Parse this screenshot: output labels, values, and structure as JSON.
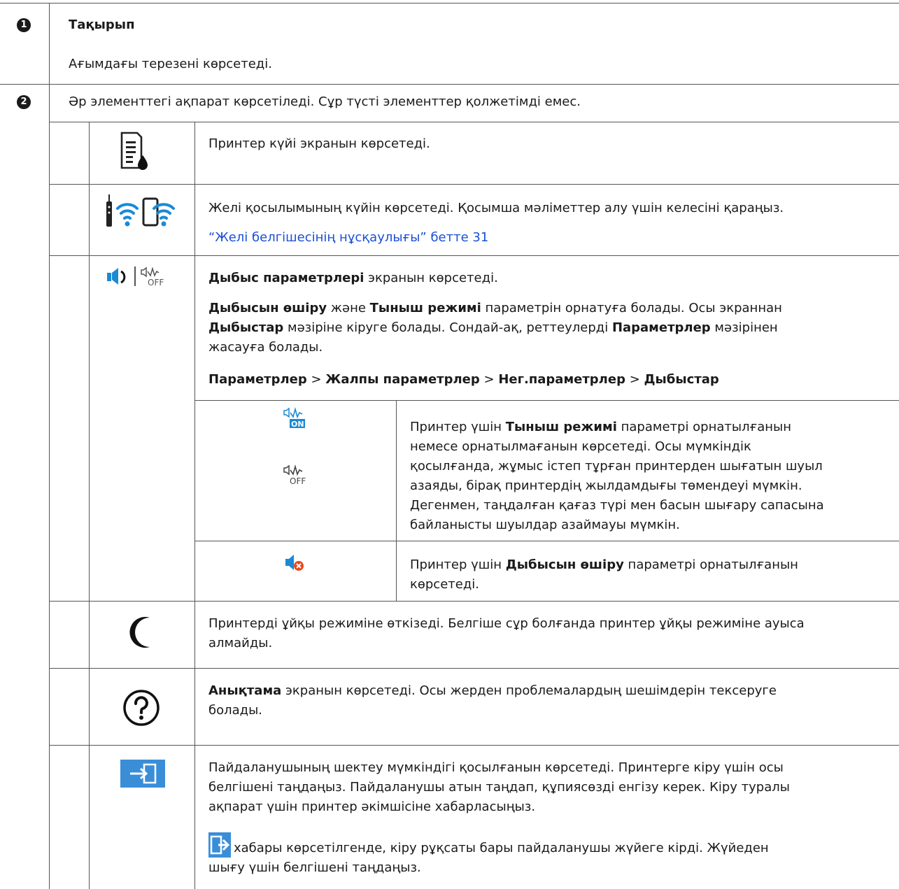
{
  "rows": {
    "r1": {
      "badge": "1",
      "title": "Тақырып",
      "desc": "Ағымдағы терезені көрсетеді."
    },
    "r2": {
      "badge": "2",
      "intro": "Әр элементтегі ақпарат көрсетіледі. Сұр түсті элементтер қолжетімді емес."
    }
  },
  "items": {
    "printer_status": {
      "icon": "printer-status-icon",
      "text": "Принтер күйі экранын көрсетеді."
    },
    "network": {
      "icon": "wifi-icon",
      "text": "Желі қосылымының күйін көрсетеді. Қосымша мәліметтер алу үшін келесіні қараңыз.",
      "link": "“Желі белгішесінің нұсқаулығы” бетте 31"
    },
    "sound": {
      "icon": "speaker-icon",
      "l1_b": "Дыбыс параметрлері",
      "l1_t": " экранын көрсетеді.",
      "l2_b1": "Дыбысын өшіру",
      "l2_t1": " және ",
      "l2_b2": "Тыныш режимі",
      "l2_t2": " параметрін орнатуға болады. Осы экраннан",
      "l3_b1": "Дыбыстар",
      "l3_t1": " мәзіріне кіруге болады. Сондай-ақ, реттеулерді ",
      "l3_b2": "Параметрлер",
      "l3_t2": " мәзірінен",
      "l4": "жасауға болады.",
      "path": [
        "Параметрлер",
        "Жалпы параметрлер",
        "Нег.параметрлер",
        "Дыбыстар"
      ],
      "sep": " > ",
      "sub": {
        "quiet_on_label": "ON",
        "quiet_off_label": "OFF",
        "quiet": {
          "p1": "Принтер үшін ",
          "b1": "Тыныш режимі",
          "p2": " параметрі орнатылғанын",
          "l2": "немесе орнатылмағанын көрсетеді. Осы мүмкіндік",
          "l3": "қосылғанда, жұмыс істеп тұрған принтерден шығатын шуыл",
          "l4": "азаяды, бірақ принтердің жылдамдығы төмендеуі мүмкін.",
          "l5": "Дегенмен, таңдалған қағаз түрі мен басын шығару сапасына",
          "l6": "байланысты шуылдар азаймауы мүмкін."
        },
        "mute": {
          "p1": "Принтер үшін ",
          "b1": "Дыбысын өшіру",
          "p2": " параметрі орнатылғанын",
          "l2": "көрсетеді."
        }
      }
    },
    "sleep": {
      "icon": "moon-icon",
      "l1": "Принтерді ұйқы режиміне өткізеді. Белгіше сұр болғанда принтер ұйқы режиміне ауыса",
      "l2": "алмайды."
    },
    "help": {
      "icon": "help-icon",
      "b1": "Анықтама",
      "t1": " экранын көрсетеді. Осы жерден проблемалардың шешімдерін тексеруге",
      "l2": "болады."
    },
    "login": {
      "icon": "login-icon",
      "l1": "Пайдаланушының шектеу мүмкіндігі қосылғанын көрсетеді. Принтерге кіру үшін осы",
      "l2": "белгішені таңдаңыз. Пайдаланушы атын таңдап, құпиясөзді енгізу керек. Кіру туралы",
      "l3": "ақпарат үшін принтер әкімшісіне хабарласыңыз.",
      "l4": " хабары көрсетілгенде, кіру рұқсаты бары пайдаланушы жүйеге кірді. Жүйеден",
      "l5": "шығу үшін белгішені таңдаңыз."
    }
  },
  "colors": {
    "accent_blue": "#1a8ad6",
    "login_bg": "#3a8ed8",
    "link": "#1a4fd6"
  }
}
